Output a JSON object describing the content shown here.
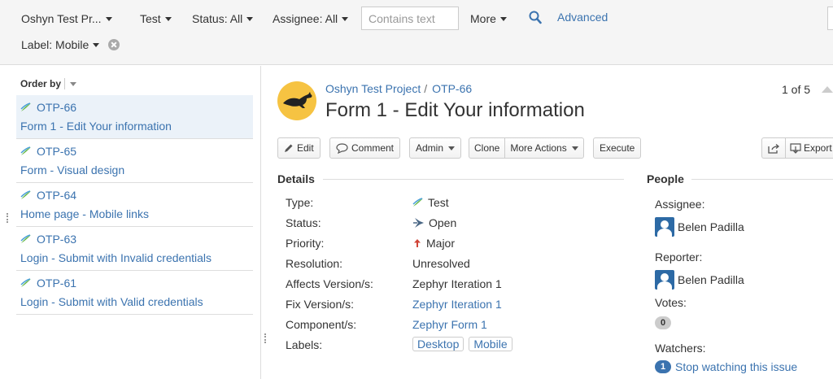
{
  "filters": {
    "project": "Oshyn Test Pr...",
    "type": "Test",
    "status": "Status: All",
    "assignee": "Assignee: All",
    "search_placeholder": "Contains text",
    "more": "More",
    "advanced": "Advanced",
    "label": "Label: Mobile"
  },
  "order_by": "Order by",
  "issues": [
    {
      "key": "OTP-66",
      "summary": "Form 1 - Edit Your information"
    },
    {
      "key": "OTP-65",
      "summary": "Form - Visual design"
    },
    {
      "key": "OTP-64",
      "summary": "Home page - Mobile links"
    },
    {
      "key": "OTP-63",
      "summary": "Login - Submit with Invalid credentials"
    },
    {
      "key": "OTP-61",
      "summary": "Login - Submit with Valid credentials"
    }
  ],
  "issue": {
    "project": "Oshyn Test Project",
    "key": "OTP-66",
    "title": "Form 1 - Edit Your information",
    "pager": "1 of 5"
  },
  "actions": {
    "edit": "Edit",
    "comment": "Comment",
    "admin": "Admin",
    "clone": "Clone",
    "more_actions": "More Actions",
    "execute": "Execute",
    "export": "Export"
  },
  "details": {
    "heading": "Details",
    "fields": [
      {
        "label": "Type:",
        "value": "Test"
      },
      {
        "label": "Status:",
        "value": "Open"
      },
      {
        "label": "Priority:",
        "value": "Major"
      },
      {
        "label": "Resolution:",
        "value": "Unresolved"
      },
      {
        "label": "Affects Version/s:",
        "value": "Zephyr Iteration 1"
      },
      {
        "label": "Fix Version/s:",
        "value": "Zephyr Iteration 1"
      },
      {
        "label": "Component/s:",
        "value": "Zephyr Form 1"
      },
      {
        "label": "Labels:",
        "value": ""
      }
    ],
    "labels": [
      "Desktop",
      "Mobile"
    ]
  },
  "people": {
    "heading": "People",
    "assignee_label": "Assignee:",
    "assignee": "Belen Padilla",
    "reporter_label": "Reporter:",
    "reporter": "Belen Padilla",
    "votes_label": "Votes:",
    "votes": "0",
    "watchers_label": "Watchers:",
    "watchers": "1",
    "watch_link": "Stop watching this issue"
  },
  "colors": {
    "link": "#3b73af",
    "selected_bg": "#ebf2f9",
    "project_avatar": "#f6c342"
  }
}
